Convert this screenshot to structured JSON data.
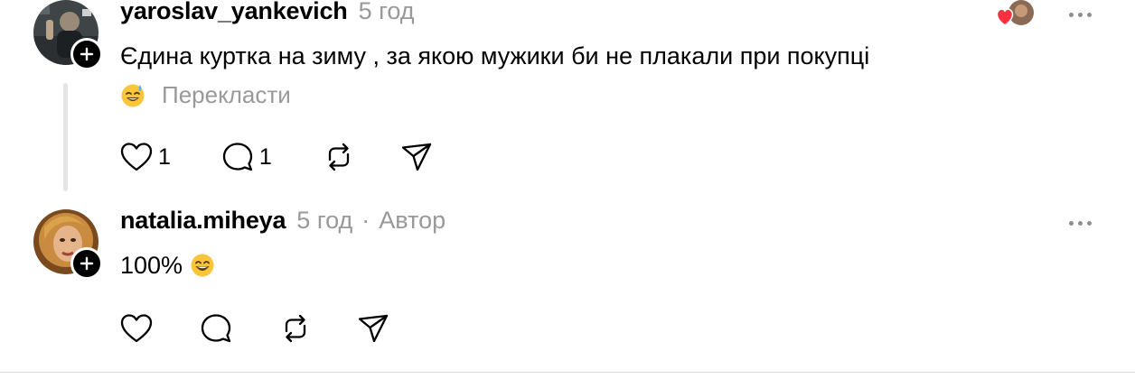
{
  "comments": [
    {
      "username": "yaroslav_yankevich",
      "time": "5 год",
      "text": "Єдина куртка на зиму , за якою мужики би не плакали при покупці",
      "translate_emoji": "sweat-smile-emoji",
      "translate_label": "Перекласти",
      "likes": "1",
      "replies": "1",
      "liked_by_author": true
    },
    {
      "username": "natalia.miheya",
      "time": "5 год",
      "separator": "·",
      "author_label": "Автор",
      "text": "100%",
      "text_emoji": "grinning-emoji",
      "likes": "",
      "replies": ""
    }
  ],
  "icons": {
    "like": "heart-outline-icon",
    "reply": "comment-bubble-icon",
    "repost": "repost-icon",
    "share": "send-icon",
    "more": "more-dots-icon",
    "follow": "plus-icon"
  },
  "colors": {
    "secondary_text": "#999999",
    "thread_line": "#e5e5e5",
    "like_red": "#ff3040"
  }
}
